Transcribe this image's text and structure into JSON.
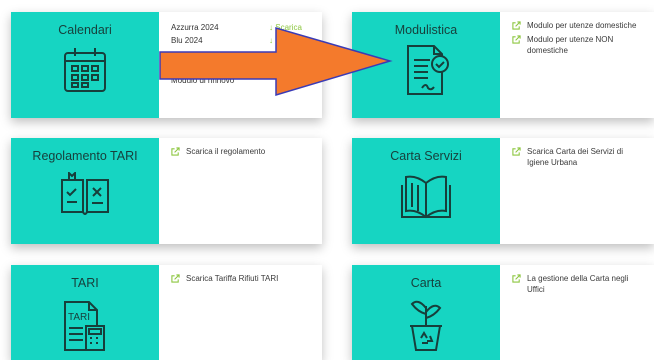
{
  "cards": [
    {
      "title": "Calendari",
      "icon": "calendar-icon",
      "items": [
        "Azzurra 2024",
        "Blu 2024",
        "Modulo di rinnovo"
      ],
      "download_label": "Scarica"
    },
    {
      "title": "Modulistica",
      "icon": "document-check-icon",
      "links": [
        "Modulo per utenze domestiche",
        "Modulo per utenze NON domestiche"
      ]
    },
    {
      "title": "Regolamento TARI",
      "icon": "checklist-book-icon",
      "links": [
        "Scarica il regolamento"
      ]
    },
    {
      "title": "Carta Servizi",
      "icon": "open-book-icon",
      "links": [
        "Scarica Carta dei Servizi di Igiene Urbana"
      ]
    },
    {
      "title": "TARI",
      "icon": "tari-calculator-icon",
      "icon_text": "TARI",
      "links": [
        "Scarica Tariffa Rifiuti TARI"
      ]
    },
    {
      "title": "Carta",
      "icon": "plant-recycle-icon",
      "links": [
        "La gestione della Carta negli Uffici"
      ]
    }
  ],
  "colors": {
    "tile": "#16d5c2",
    "arrow_fill": "#f47a2c",
    "arrow_stroke": "#3b3bb5",
    "link_icon": "#8cc63f"
  }
}
